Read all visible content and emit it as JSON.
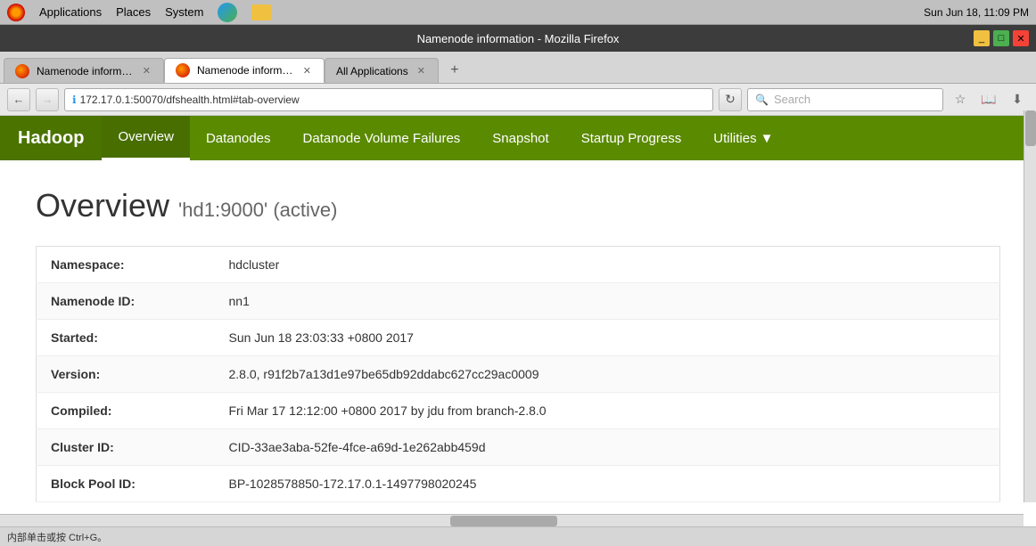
{
  "os_bar": {
    "menus": [
      "Applications",
      "Places",
      "System"
    ],
    "datetime": "Sun Jun 18, 11:09 PM"
  },
  "browser": {
    "title": "Namenode information - Mozilla Firefox",
    "tabs": [
      {
        "label": "Namenode information",
        "active": false
      },
      {
        "label": "Namenode information",
        "active": true
      },
      {
        "label": "All Applications",
        "active": false
      }
    ],
    "url": "172.17.0.1:50070/dfshealth.html#tab-overview",
    "search_placeholder": "Search"
  },
  "nav": {
    "logo": "Hadoop",
    "items": [
      {
        "label": "Overview",
        "active": true
      },
      {
        "label": "Datanodes",
        "active": false
      },
      {
        "label": "Datanode Volume Failures",
        "active": false
      },
      {
        "label": "Snapshot",
        "active": false
      },
      {
        "label": "Startup Progress",
        "active": false
      },
      {
        "label": "Utilities",
        "active": false,
        "has_dropdown": true
      }
    ]
  },
  "page": {
    "title": "Overview",
    "subtitle": "'hd1:9000' (active)"
  },
  "table": {
    "rows": [
      {
        "label": "Namespace:",
        "value": "hdcluster"
      },
      {
        "label": "Namenode ID:",
        "value": "nn1"
      },
      {
        "label": "Started:",
        "value": "Sun Jun 18 23:03:33 +0800 2017"
      },
      {
        "label": "Version:",
        "value": "2.8.0, r91f2b7a13d1e97be65db92ddabc627cc29ac0009"
      },
      {
        "label": "Compiled:",
        "value": "Fri Mar 17 12:12:00 +0800 2017 by jdu from branch-2.8.0"
      },
      {
        "label": "Cluster ID:",
        "value": "CID-33ae3aba-52fe-4fce-a69d-1e262abb459d"
      },
      {
        "label": "Block Pool ID:",
        "value": "BP-1028578850-172.17.0.1-1497798020245"
      }
    ]
  },
  "status_bar": {
    "text": "内部单击或按 Ctrl+G。"
  }
}
